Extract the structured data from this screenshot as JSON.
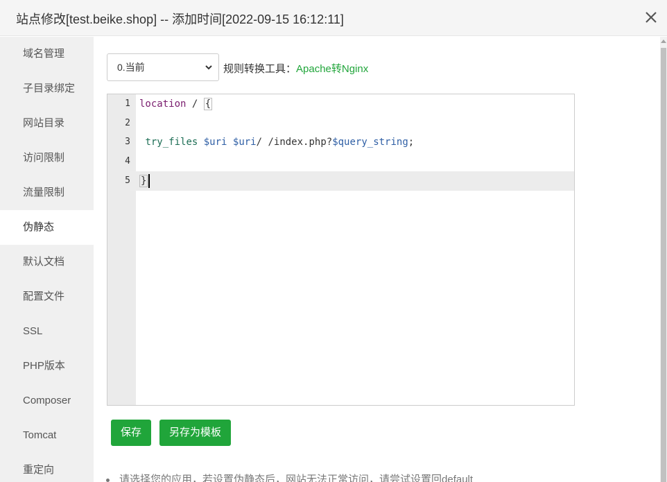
{
  "window": {
    "title": "站点修改[test.beike.shop] -- 添加时间[2022-09-15 16:12:11]",
    "close_icon": "close-icon"
  },
  "sidebar": {
    "items": [
      {
        "label": "域名管理",
        "active": false
      },
      {
        "label": "子目录绑定",
        "active": false
      },
      {
        "label": "网站目录",
        "active": false
      },
      {
        "label": "访问限制",
        "active": false
      },
      {
        "label": "流量限制",
        "active": false
      },
      {
        "label": "伪静态",
        "active": true
      },
      {
        "label": "默认文档",
        "active": false
      },
      {
        "label": "配置文件",
        "active": false
      },
      {
        "label": "SSL",
        "active": false
      },
      {
        "label": "PHP版本",
        "active": false
      },
      {
        "label": "Composer",
        "active": false
      },
      {
        "label": "Tomcat",
        "active": false
      },
      {
        "label": "重定向",
        "active": false
      }
    ]
  },
  "rewrite": {
    "select_value": "0.当前",
    "tool_label": "规则转换工具：",
    "tool_link": "Apache转Nginx"
  },
  "editor": {
    "lines": [
      {
        "num": "1",
        "text": "location / {"
      },
      {
        "num": "2",
        "text": ""
      },
      {
        "num": "3",
        "text": " try_files $uri $uri/ /index.php?$query_string;"
      },
      {
        "num": "4",
        "text": ""
      },
      {
        "num": "5",
        "text": "}"
      }
    ],
    "active_line": 5
  },
  "actions": {
    "save_label": "保存",
    "save_template_label": "另存为模板"
  },
  "tip": "请选择您的应用，若设置伪静态后，网站无法正常访问，请尝试设置回default",
  "colors": {
    "accent": "#20a53a",
    "sidebar_bg": "#f0f0f0",
    "gutter_bg": "#ebebeb"
  }
}
